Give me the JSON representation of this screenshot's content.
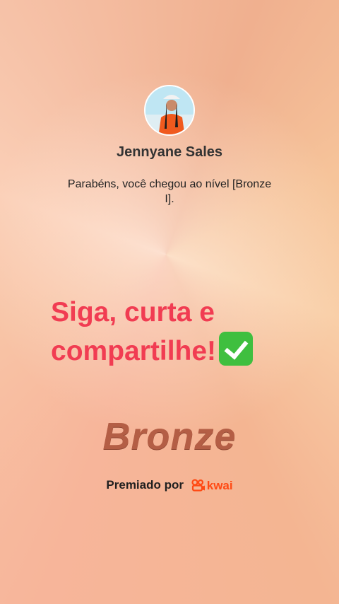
{
  "profile": {
    "name": "Jennyane Sales",
    "message": "Parabéns, você chegou ao nível [Bronze I]."
  },
  "cta": {
    "line1": "Siga, curta e",
    "line2": "compartilhe!"
  },
  "level": {
    "title": "Bronze"
  },
  "footer": {
    "premiado": "Premiado por",
    "brand": "kwai"
  },
  "colors": {
    "cta": "#f13c52",
    "bronze": "#b45e45",
    "kwai": "#ff4a14"
  }
}
